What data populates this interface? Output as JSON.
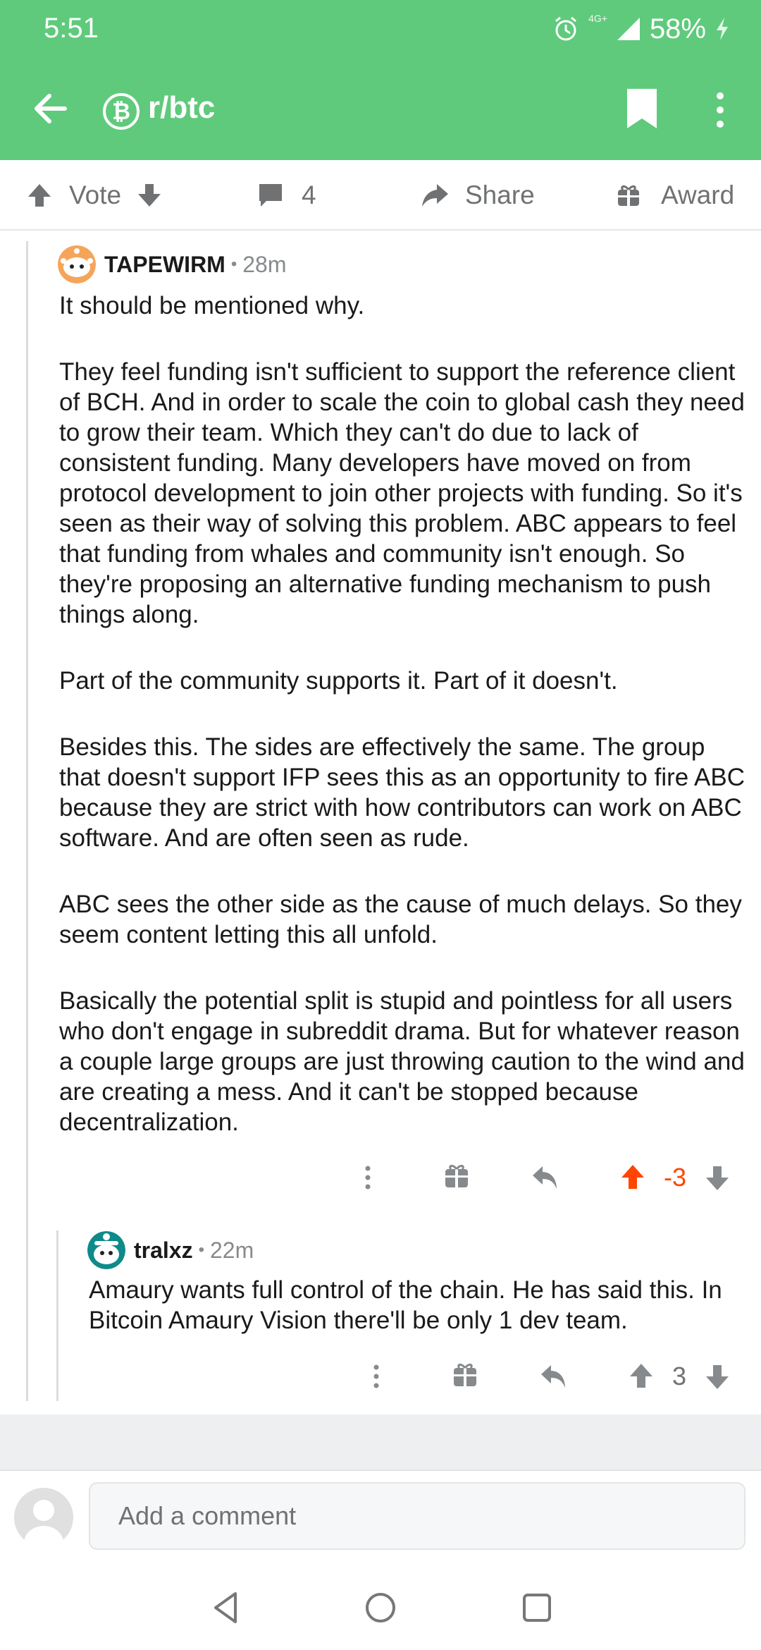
{
  "status": {
    "time": "5:51",
    "network": "4G+",
    "battery": "58%"
  },
  "header": {
    "subreddit": "r/btc",
    "subreddit_icon": "bitcoin-icon",
    "accent_color": "#5fca7c"
  },
  "actions": {
    "vote_label": "Vote",
    "comment_count": "4",
    "share_label": "Share",
    "award_label": "Award"
  },
  "comments": [
    {
      "username": "TAPEWIRM",
      "separator": "•",
      "age": "28m",
      "paragraphs": [
        "It should be mentioned why.",
        "They feel funding isn't sufficient to support the reference client of BCH. And in order to scale the coin to global cash they need to grow their team. Which they can't do due to lack of consistent funding. Many developers have moved on from protocol development to join other projects with funding. So it's seen as their way of solving this problem. ABC appears to feel that funding from whales and community isn't enough. So they're proposing an alternative funding mechanism to push things along.",
        "Part of the community supports it. Part of it doesn't.",
        "Besides this. The sides are effectively the same. The group that doesn't support IFP sees this as an opportunity to fire ABC because they are strict with how contributors can work on ABC software. And are often seen as rude.",
        "ABC sees the other side as the cause of much delays. So they seem content letting this all unfold.",
        "Basically the potential split is stupid and pointless for all users who don't engage in subreddit drama. But for whatever reason a couple large groups are just throwing caution to the wind and are creating a mess. And it can't be stopped because decentralization."
      ],
      "score": "-3",
      "upvoted": true
    },
    {
      "username": "tralxz",
      "separator": "•",
      "age": "22m",
      "paragraphs": [
        "Amaury wants full control of the chain. He has said this. In Bitcoin Amaury Vision there'll be only 1 dev team."
      ],
      "score": "3",
      "upvoted": false
    }
  ],
  "composer": {
    "placeholder": "Add a comment"
  },
  "colors": {
    "upvote": "#ff4500",
    "muted": "#6f7173"
  }
}
